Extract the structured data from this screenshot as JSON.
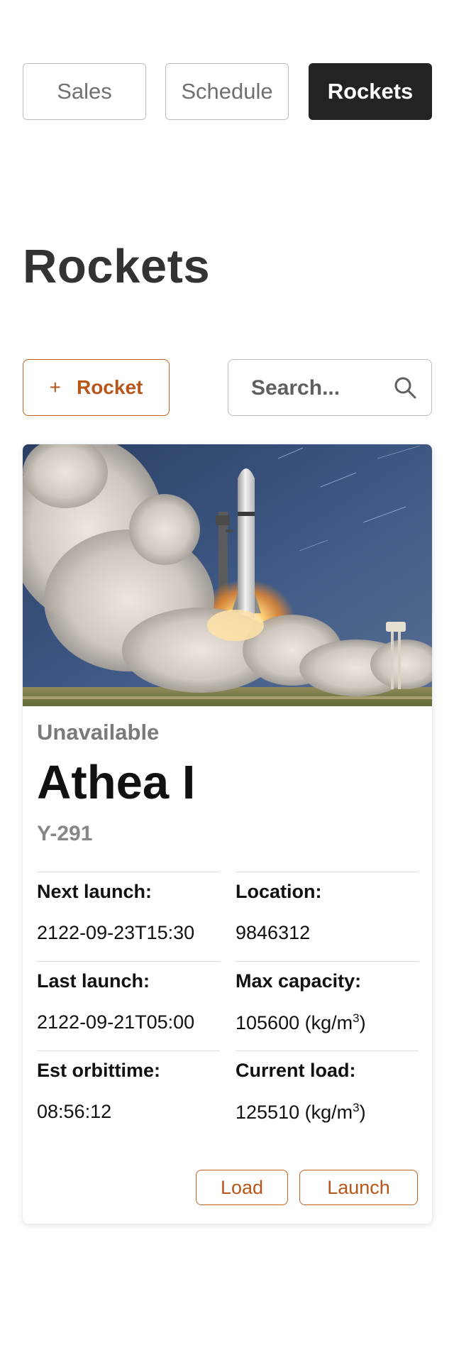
{
  "nav": {
    "tabs": [
      {
        "label": "Sales",
        "active": false
      },
      {
        "label": "Schedule",
        "active": false
      },
      {
        "label": "Rockets",
        "active": true
      }
    ]
  },
  "page": {
    "title": "Rockets"
  },
  "toolbar": {
    "add_icon": "+",
    "add_label": "Rocket",
    "search_placeholder": "Search..."
  },
  "rocket": {
    "status": "Unavailable",
    "name": "Athea I",
    "code": "Y-291",
    "fields": {
      "next_launch": {
        "label": "Next launch:",
        "value": "2122-09-23T15:30"
      },
      "location": {
        "label": "Location:",
        "value": "9846312"
      },
      "last_launch": {
        "label": "Last launch:",
        "value": "2122-09-21T05:00"
      },
      "max_capacity": {
        "label": "Max capacity:",
        "value": "105600",
        "unit_pre": "(kg/m",
        "unit_sup": "3",
        "unit_post": ")"
      },
      "est_orbittime": {
        "label": "Est orbittime:",
        "value": "08:56:12"
      },
      "current_load": {
        "label": "Current load:",
        "value": "125510",
        "unit_pre": "(kg/m",
        "unit_sup": "3",
        "unit_post": ")"
      }
    },
    "actions": {
      "load_label": "Load",
      "launch_label": "Launch"
    }
  },
  "colors": {
    "accent": "#c25e1c",
    "active_tab": "#232323",
    "muted_text": "#7a7a7a"
  },
  "icons": {
    "search": "search-icon",
    "add": "plus-icon"
  }
}
